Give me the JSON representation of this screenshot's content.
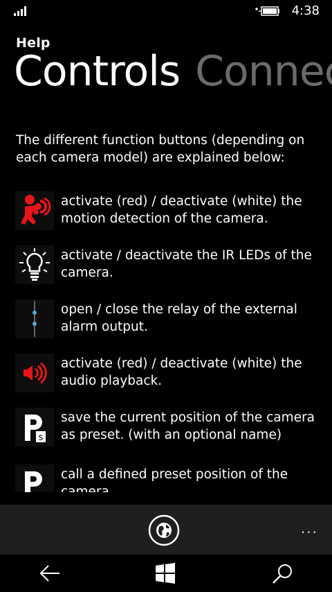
{
  "status": {
    "time": "4:38"
  },
  "app_title": "Help",
  "pivot": {
    "tabs": [
      "Controls",
      "Connec"
    ]
  },
  "intro": "The different function buttons (depending on each camera model) are explained below:",
  "items": [
    {
      "icon": "motion-detection-icon",
      "text": "activate (red) / deactivate (white) the motion detection of the camera."
    },
    {
      "icon": "ir-led-bulb-icon",
      "text": "activate / deactivate the IR LEDs of the camera."
    },
    {
      "icon": "relay-switch-icon",
      "text": "open / close the relay of the external alarm output."
    },
    {
      "icon": "speaker-audio-icon",
      "text": "activate (red) / deactivate (white) the audio playback."
    },
    {
      "icon": "save-preset-icon",
      "text": "save the current position of the camera as preset. (with an optional name)"
    },
    {
      "icon": "call-preset-icon",
      "text": "call a defined preset position of the camera."
    }
  ],
  "appbar": {
    "more": "..."
  },
  "colors": {
    "background": "#000000",
    "appbar": "#1f1f1f",
    "inactive_tab": "#6b6b6b",
    "alert_red": "#e8141b",
    "relay_blue": "#5aa7d6"
  }
}
